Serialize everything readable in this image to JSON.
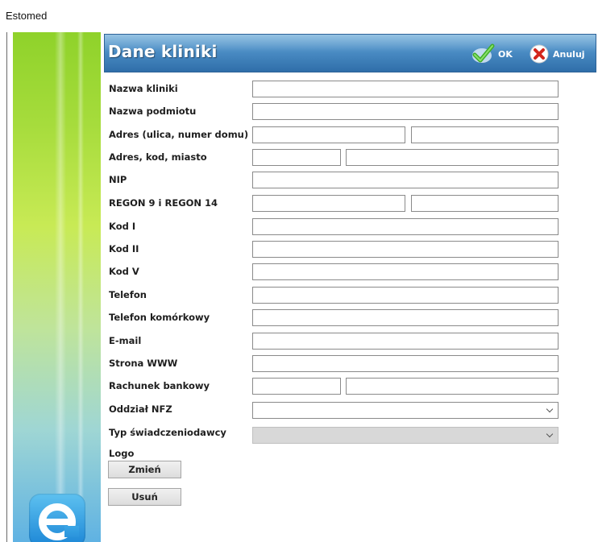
{
  "app": {
    "title": "Estomed"
  },
  "header": {
    "title": "Dane kliniki",
    "ok_label": "OK",
    "cancel_label": "Anuluj"
  },
  "form": {
    "labels": {
      "clinic_name": "Nazwa kliniki",
      "entity_name": "Nazwa podmiotu",
      "address_street": "Adres (ulica, numer domu)",
      "address_city": "Adres, kod, miasto",
      "nip": "NIP",
      "regon": "REGON 9 i REGON 14",
      "code1": "Kod I",
      "code2": "Kod II",
      "code5": "Kod V",
      "phone": "Telefon",
      "mobile": "Telefon komórkowy",
      "email": "E-mail",
      "website": "Strona WWW",
      "bank": "Rachunek bankowy",
      "nfz": "Oddział NFZ",
      "provider_type": "Typ świadczeniodawcy",
      "logo": "Logo"
    },
    "values": {
      "clinic_name": "",
      "entity_name": "",
      "street": "",
      "house_number": "",
      "postal_code": "",
      "city": "",
      "nip": "",
      "regon9": "",
      "regon14": "",
      "code1": "",
      "code2": "",
      "code5": "",
      "phone": "",
      "mobile": "",
      "email": "",
      "website": "",
      "bank_part1": "",
      "bank_part2": "",
      "nfz": "",
      "provider_type": ""
    }
  },
  "logo_buttons": {
    "change_label": "Zmień",
    "remove_label": "Usuń"
  },
  "icons": {
    "ok": "check-icon",
    "cancel": "close-icon",
    "brand": "e-logo-icon"
  },
  "colors": {
    "header": "#4a8cc4",
    "sidebar_top": "#8fd22a",
    "sidebar_bottom": "#5fb2e3"
  }
}
